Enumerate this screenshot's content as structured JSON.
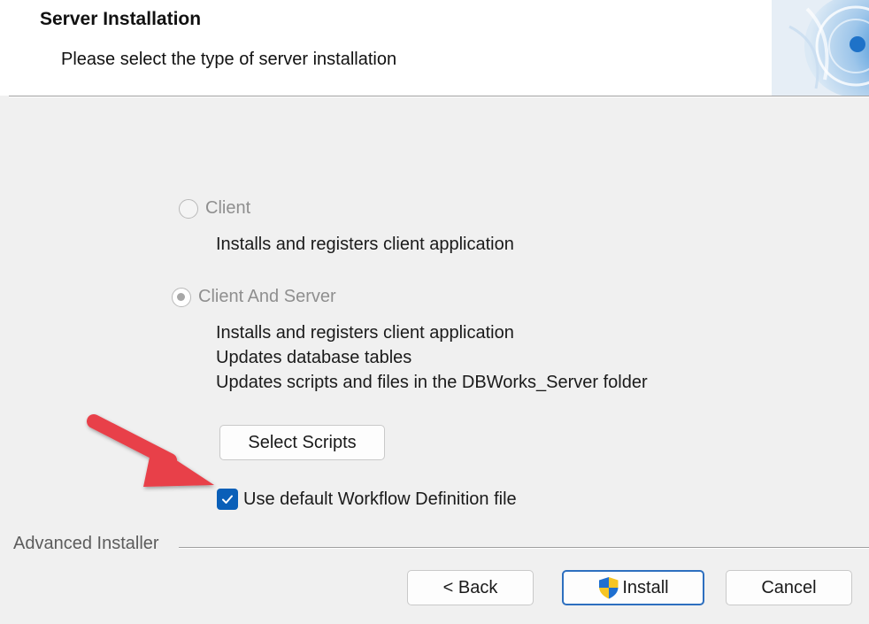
{
  "header": {
    "title": "Server Installation",
    "subtitle": "Please select the type of server installation"
  },
  "options": {
    "client": {
      "label": "Client",
      "description": [
        "Installs and registers client application"
      ],
      "selected": false,
      "enabled": false
    },
    "client_and_server": {
      "label": "Client And Server",
      "description": [
        "Installs and registers client application",
        "Updates database tables",
        "Updates scripts and files in the DBWorks_Server folder"
      ],
      "selected": true,
      "enabled": false
    }
  },
  "select_scripts_label": "Select Scripts",
  "checkbox": {
    "label": "Use default Workflow Definition file",
    "checked": true
  },
  "footer": {
    "brand": "Advanced Installer",
    "back_label": "< Back",
    "install_label": "Install",
    "cancel_label": "Cancel"
  },
  "colors": {
    "accent": "#0a5fb8",
    "annotation_arrow": "#e8404a",
    "install_border": "#2d6fbf"
  },
  "icons": [
    "installer-logo-icon",
    "uac-shield-icon",
    "checkmark-icon",
    "annotation-arrow-icon"
  ]
}
